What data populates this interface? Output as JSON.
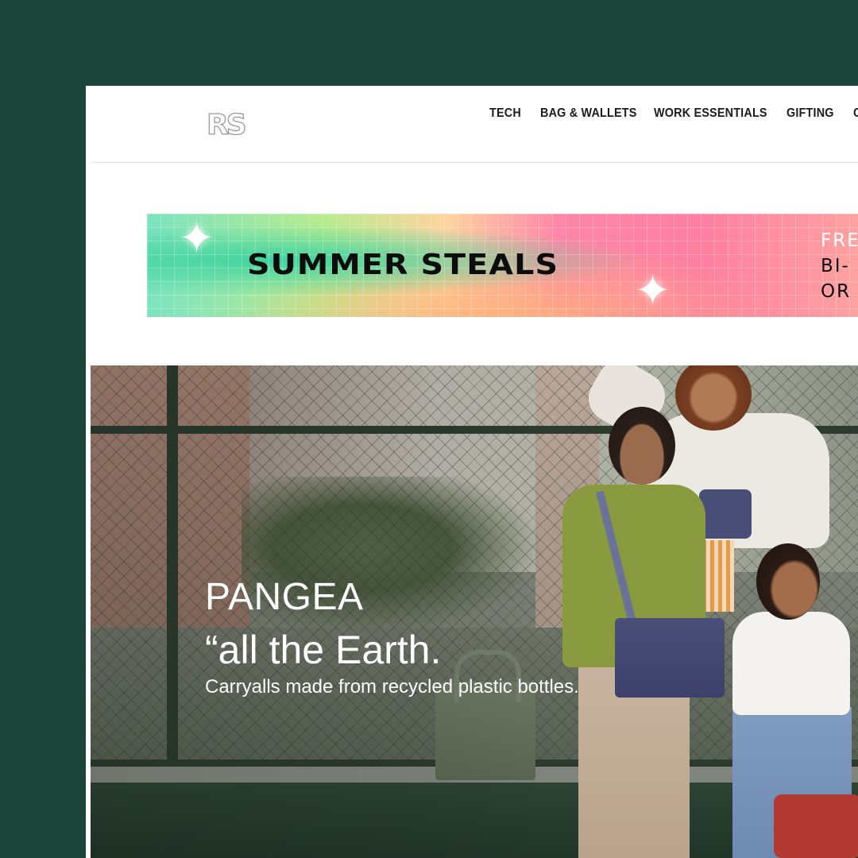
{
  "header": {
    "logo_text": "RS",
    "nav": [
      "TECH",
      "BAG & WALLETS",
      "WORK ESSENTIALS",
      "GIFTING",
      "CO"
    ]
  },
  "promo": {
    "title": "SUMMER STEALS",
    "side_lines": [
      "FRE",
      "BI-",
      "OR"
    ]
  },
  "hero": {
    "title": "PANGEA",
    "quote": "“all the Earth.",
    "subtitle": "Carryalls made from recycled plastic bottles."
  },
  "colors": {
    "frame_bg": "#1b4538",
    "page_bg": "#ffffff",
    "nav_text": "#1d1d1d"
  }
}
